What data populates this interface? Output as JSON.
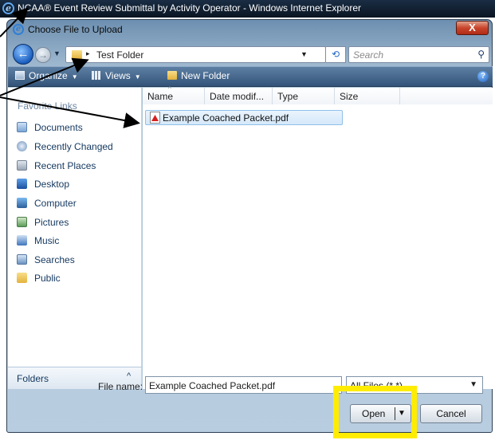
{
  "ie_window": {
    "title": "NCAA® Event Review Submittal by Activity Operator - Windows Internet Explorer",
    "icon": "ie-logo"
  },
  "dialog": {
    "title": "Choose File to Upload",
    "close_label": "X"
  },
  "navigation": {
    "back_glyph": "←",
    "forward_glyph": "→",
    "address_separator": "▸",
    "address": "Test Folder",
    "refresh_glyph": "⟲",
    "search_placeholder": "Search",
    "search_glyph": "⚲"
  },
  "toolbar": {
    "organize_label": "Organize",
    "views_label": "Views",
    "new_folder_label": "New Folder",
    "help_label": "?"
  },
  "sidebar": {
    "heading": "Favorite Links",
    "items": [
      {
        "label": "Documents",
        "icon": "documents-icon"
      },
      {
        "label": "Recently Changed",
        "icon": "recently-changed-icon"
      },
      {
        "label": "Recent Places",
        "icon": "recent-places-icon"
      },
      {
        "label": "Desktop",
        "icon": "desktop-icon"
      },
      {
        "label": "Computer",
        "icon": "computer-icon"
      },
      {
        "label": "Pictures",
        "icon": "pictures-icon"
      },
      {
        "label": "Music",
        "icon": "music-icon"
      },
      {
        "label": "Searches",
        "icon": "searches-icon"
      },
      {
        "label": "Public",
        "icon": "public-folder-icon"
      }
    ],
    "folders_label": "Folders",
    "folders_chevron": "^"
  },
  "filelist": {
    "columns": [
      "Name",
      "Date modif...",
      "Type",
      "Size"
    ],
    "files": [
      {
        "name": "Example Coached Packet.pdf",
        "icon": "pdf-icon"
      }
    ]
  },
  "bottom": {
    "file_name_label": "File name:",
    "file_name_value": "Example Coached Packet.pdf",
    "file_type_value": "All Files (*.*)",
    "open_label": "Open",
    "cancel_label": "Cancel"
  },
  "colors": {
    "highlight": "#ffec00",
    "toolbar": "#34547a",
    "selection": "#d5e8fa"
  }
}
